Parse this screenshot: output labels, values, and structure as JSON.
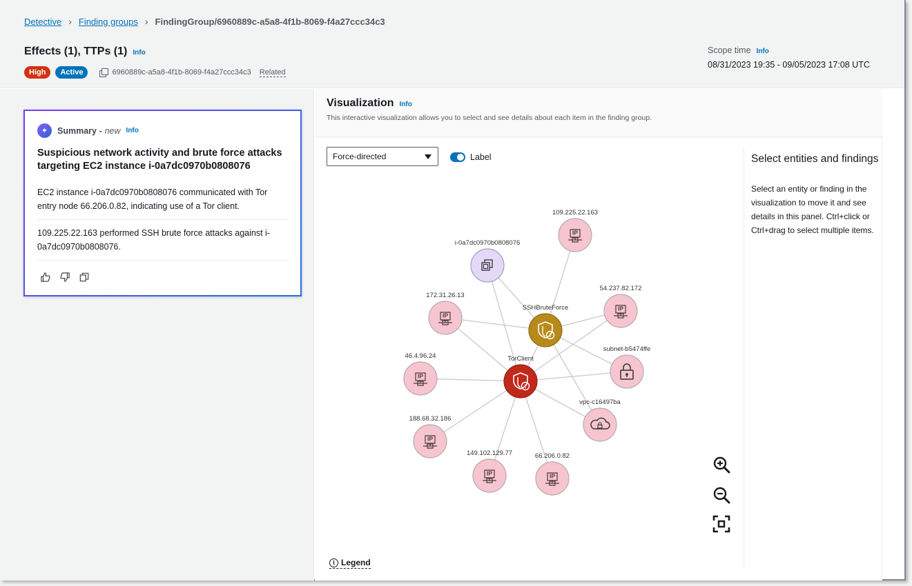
{
  "breadcrumb": {
    "items": [
      "Detective",
      "Finding groups"
    ],
    "current": "FindingGroup/6960889c-a5a8-4f1b-8069-f4a27ccc34c3"
  },
  "header": {
    "title": "Effects (1), TTPs (1)",
    "info": "Info",
    "badge_severity": "High",
    "badge_status": "Active",
    "group_id": "6960889c-a5a8-4f1b-8069-f4a27ccc34c3",
    "related": "Related",
    "scope_label": "Scope time",
    "scope_info": "Info",
    "scope_value": "08/31/2023 19:35 - 09/05/2023 17:08 UTC"
  },
  "summary": {
    "label": "Summary -",
    "new": "new",
    "info": "Info",
    "title": "Suspicious network activity and brute force attacks targeting EC2 instance i-0a7dc0970b0808076",
    "paragraphs": [
      "EC2 instance i-0a7dc0970b0808076 communicated with Tor entry node 66.206.0.82, indicating use of a Tor client.",
      "109.225.22.163 performed SSH brute force attacks against i-0a7dc0970b0808076."
    ]
  },
  "visualization": {
    "title": "Visualization",
    "info": "Info",
    "description": "This interactive visualization allows you to select and see details about each item in the finding group.",
    "layout_value": "Force-directed",
    "label_toggle": "Label",
    "legend": "Legend",
    "details_title": "Select entities and findings",
    "details_text": "Select an entity or finding in the visualization to move it and see details in this panel. Ctrl+click or Ctrl+drag to select multiple items."
  },
  "graph": {
    "node_colors": {
      "ip": "#f6c5cf",
      "instance": "#e3d9f6",
      "finding_high": "#c1291b",
      "finding_medium": "#b88a1b",
      "network": "#f6c5cf"
    },
    "nodes": [
      {
        "id": "instance",
        "label": "i-0a7dc0970b0808076",
        "type": "instance"
      },
      {
        "id": "ip1",
        "label": "109.225.22.163",
        "type": "ip"
      },
      {
        "id": "ip2",
        "label": "172.31.26.13",
        "type": "ip"
      },
      {
        "id": "ssh",
        "label": "SSHBruteForce",
        "type": "finding_medium"
      },
      {
        "id": "ip3",
        "label": "54.237.82.172",
        "type": "ip"
      },
      {
        "id": "subnet",
        "label": "subnet-b5474ffe",
        "type": "subnet"
      },
      {
        "id": "tor",
        "label": "TorClient",
        "type": "finding_high"
      },
      {
        "id": "ip4",
        "label": "46.4.96.24",
        "type": "ip"
      },
      {
        "id": "vpc",
        "label": "vpc-c16497ba",
        "type": "vpc"
      },
      {
        "id": "ip5",
        "label": "188.68.32.186",
        "type": "ip"
      },
      {
        "id": "ip6",
        "label": "149.102.129.77",
        "type": "ip"
      },
      {
        "id": "ip7",
        "label": "66.206.0.82",
        "type": "ip"
      }
    ],
    "edges": [
      [
        "instance",
        "ssh"
      ],
      [
        "instance",
        "tor"
      ],
      [
        "ip1",
        "ssh"
      ],
      [
        "ip2",
        "ssh"
      ],
      [
        "ip2",
        "tor"
      ],
      [
        "ip3",
        "ssh"
      ],
      [
        "ip3",
        "tor"
      ],
      [
        "ssh",
        "subnet"
      ],
      [
        "ssh",
        "vpc"
      ],
      [
        "ssh",
        "tor"
      ],
      [
        "tor",
        "subnet"
      ],
      [
        "tor",
        "vpc"
      ],
      [
        "tor",
        "ip4"
      ],
      [
        "tor",
        "ip5"
      ],
      [
        "tor",
        "ip6"
      ],
      [
        "tor",
        "ip7"
      ]
    ]
  }
}
